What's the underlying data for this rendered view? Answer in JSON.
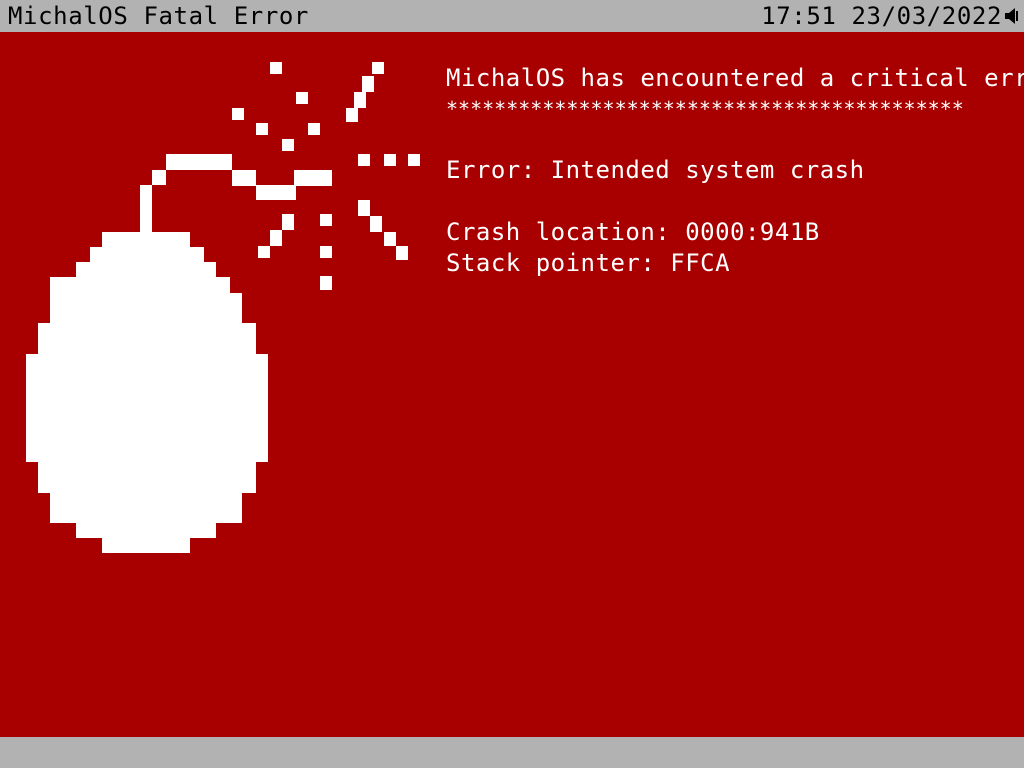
{
  "window": {
    "title": "MichalOS Fatal Error",
    "time": "17:51",
    "date": "23/03/2022",
    "speaker_icon": "speaker-icon"
  },
  "colors": {
    "background": "#a80000",
    "bar": "#b2b2b2",
    "text": "#ffffff"
  },
  "error": {
    "headline": "MichalOS has encountered a critical error.",
    "separator": "*******************************************",
    "message": "Error: Intended system crash",
    "crash_location": "Crash location: 0000:941B",
    "stack_pointer": "Stack pointer: FFCA"
  },
  "illustration": {
    "icon": "bomb-icon"
  }
}
